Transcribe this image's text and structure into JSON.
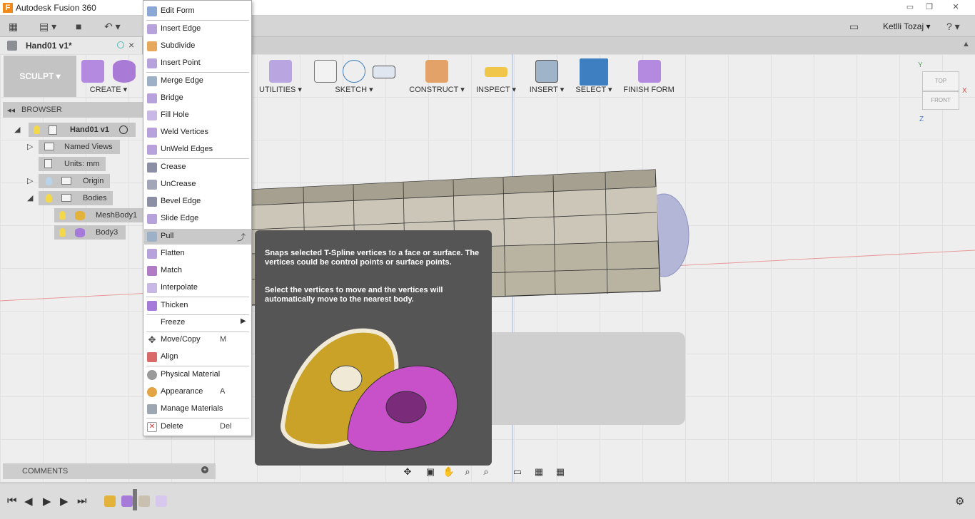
{
  "app": {
    "title": "Autodesk Fusion 360",
    "logo_letter": "F"
  },
  "window_controls": {
    "minimize": "▭",
    "restore": "❐",
    "close": "✕"
  },
  "user": {
    "name": "Ketlli Tozaj"
  },
  "document": {
    "tab_label": "Hand01 v1*"
  },
  "toolbar": {
    "workspace": "SCULPT ▾",
    "groups": [
      "CREATE ▾",
      "UTILITIES ▾",
      "SKETCH ▾",
      "CONSTRUCT ▾",
      "INSPECT ▾",
      "INSERT ▾",
      "SELECT ▾",
      "FINISH FORM"
    ]
  },
  "browser": {
    "title": "BROWSER",
    "items": [
      {
        "label": "Hand01 v1"
      },
      {
        "label": "Named Views"
      },
      {
        "label": "Units: mm"
      },
      {
        "label": "Origin"
      },
      {
        "label": "Bodies"
      },
      {
        "label": "MeshBody1"
      },
      {
        "label": "Body3"
      }
    ]
  },
  "menu": {
    "items": [
      {
        "label": "Edit Form",
        "icon": "edit-form-icon"
      },
      {
        "label": "Insert Edge",
        "icon": "insert-edge-icon"
      },
      {
        "label": "Subdivide",
        "icon": "subdivide-icon"
      },
      {
        "label": "Insert Point",
        "icon": "insert-point-icon"
      },
      {
        "label": "Merge Edge",
        "icon": "merge-edge-icon"
      },
      {
        "label": "Bridge",
        "icon": "bridge-icon"
      },
      {
        "label": "Fill Hole",
        "icon": "fill-hole-icon"
      },
      {
        "label": "Weld Vertices",
        "icon": "weld-vertices-icon"
      },
      {
        "label": "UnWeld Edges",
        "icon": "unweld-edges-icon"
      },
      {
        "label": "Crease",
        "icon": "crease-icon"
      },
      {
        "label": "UnCrease",
        "icon": "uncrease-icon"
      },
      {
        "label": "Bevel Edge",
        "icon": "bevel-edge-icon"
      },
      {
        "label": "Slide Edge",
        "icon": "slide-edge-icon"
      },
      {
        "label": "Pull",
        "icon": "pull-icon"
      },
      {
        "label": "Flatten",
        "icon": "flatten-icon"
      },
      {
        "label": "Match",
        "icon": "match-icon"
      },
      {
        "label": "Interpolate",
        "icon": "interpolate-icon"
      },
      {
        "label": "Thicken",
        "icon": "thicken-icon"
      },
      {
        "label": "Freeze",
        "icon": "freeze-icon"
      },
      {
        "label": "Move/Copy",
        "shortcut": "M",
        "icon": "move-copy-icon"
      },
      {
        "label": "Align",
        "icon": "align-icon"
      },
      {
        "label": "Physical Material",
        "icon": "physical-material-icon"
      },
      {
        "label": "Appearance",
        "shortcut": "A",
        "icon": "appearance-icon"
      },
      {
        "label": "Manage Materials",
        "icon": "manage-materials-icon"
      },
      {
        "label": "Delete",
        "shortcut": "Del",
        "icon": "delete-icon"
      }
    ]
  },
  "tooltip": {
    "paragraph1": "Snaps selected T-Spline vertices to a face or surface. The vertices could be control points or surface points.",
    "paragraph2": "Select the vertices to move and the vertices will automatically move to the nearest body."
  },
  "comments": {
    "label": "COMMENTS"
  },
  "viewcube": {
    "top": "TOP",
    "front": "FRONT",
    "axis_y": "Y",
    "axis_x": "X",
    "axis_z": "Z"
  },
  "colors": {
    "accent": "#3d7fc1",
    "menu_hover": "#c9c9c9",
    "tooltip_bg": "#555555"
  }
}
